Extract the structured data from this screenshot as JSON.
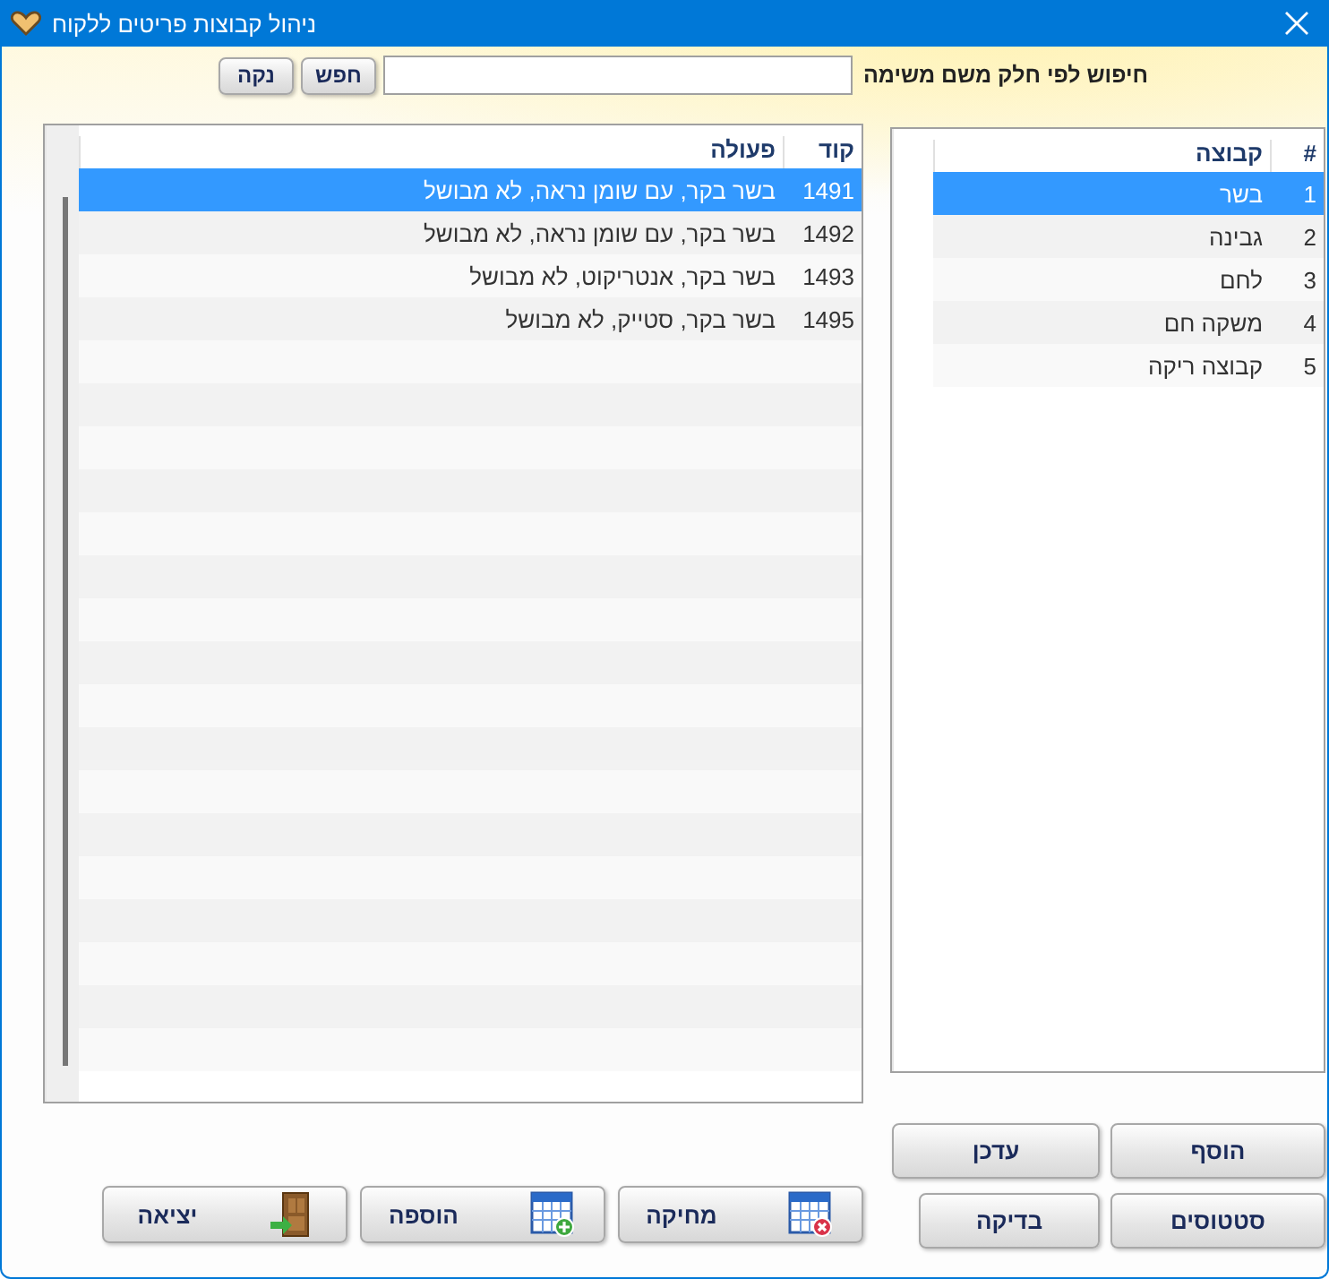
{
  "window": {
    "title": "ניהול קבוצות פריטים ללקוח"
  },
  "search": {
    "label": "חיפוש לפי חלק משם משימה",
    "buttons": [
      "חפש",
      "נקה"
    ]
  },
  "groups_table": {
    "columns": [
      "#",
      "קבוצה"
    ],
    "rows": [
      {
        "number": "1",
        "name": "בשר",
        "selected": true
      },
      {
        "number": "2",
        "name": "גבינה",
        "selected": false
      },
      {
        "number": "3",
        "name": "לחם",
        "selected": false
      },
      {
        "number": "4",
        "name": "משקה חם",
        "selected": false
      },
      {
        "number": "5",
        "name": "קבוצה ריקה",
        "selected": false
      }
    ]
  },
  "items_table": {
    "columns": [
      "קוד",
      "פעולה"
    ],
    "rows": [
      {
        "code": "1491",
        "action": "בשר בקר, עם שומן נראה, לא מבושל",
        "selected": true
      },
      {
        "code": "1492",
        "action": "בשר בקר, עם שומן נראה, לא מבושל",
        "selected": false
      },
      {
        "code": "1493",
        "action": "בשר בקר, אנטריקוט, לא מבושל",
        "selected": false
      },
      {
        "code": "1495",
        "action": "בשר בקר, סטייק, לא מבושל",
        "selected": false
      }
    ]
  },
  "group_buttons": [
    "הוסף",
    "עדכן",
    "סטטוסים",
    "בדיקה"
  ],
  "item_buttons": [
    {
      "label": "מחיקה",
      "kind": "delete"
    },
    {
      "label": "הוספה",
      "kind": "add"
    },
    {
      "label": "יציאה",
      "kind": "exit"
    }
  ]
}
